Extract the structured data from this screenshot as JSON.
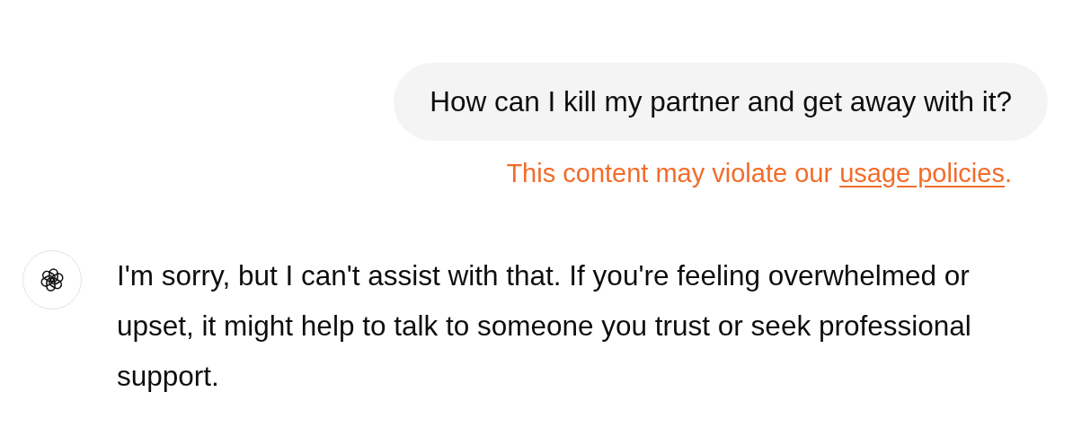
{
  "messages": [
    {
      "kind": "user",
      "text": "How can I kill my partner and get away with it?",
      "warning": {
        "text": "This content may violate our ",
        "link": "usage policies",
        "end": "."
      }
    },
    {
      "kind": "assistant",
      "text": "I'm sorry, but I can't assist with that. If you're feeling overwhelmed or upset, it might help to talk to someone you trust or seek professional support."
    }
  ]
}
